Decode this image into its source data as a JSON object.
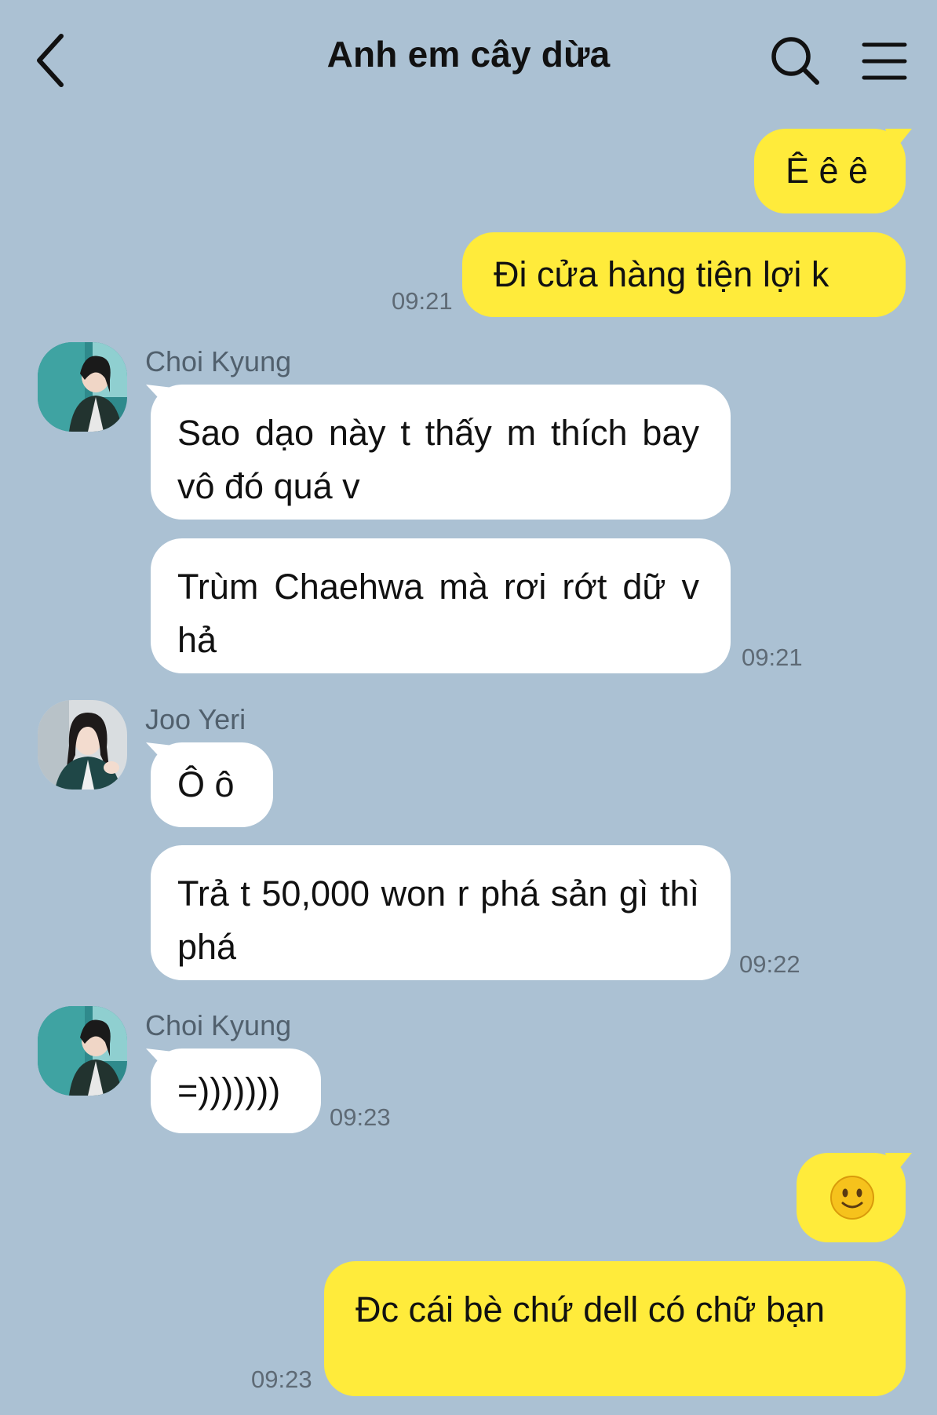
{
  "header": {
    "title": "Anh em cây dừa",
    "back_icon": "chevron-left-icon",
    "search_icon": "search-icon",
    "menu_icon": "hamburger-menu-icon"
  },
  "colors": {
    "background": "#abc1d3",
    "my_bubble": "#ffeb3b",
    "their_bubble": "#ffffff",
    "timestamp": "#5e6a75",
    "sender_name": "#51606d"
  },
  "messages": [
    {
      "from": "me",
      "text": "Ê ê ê"
    },
    {
      "from": "me",
      "text": "Đi cửa hàng tiện lợi k",
      "time": "09:21"
    },
    {
      "from": "Choi Kyung",
      "sender_label": "Choi Kyung",
      "text": "Sao dạo này t thấy m thích bay vô đó quá v"
    },
    {
      "from": "Choi Kyung",
      "text": "Trùm Chaehwa mà rơi rớt dữ v hả",
      "time": "09:21"
    },
    {
      "from": "Joo Yeri",
      "sender_label": "Joo Yeri",
      "text": "Ô ô"
    },
    {
      "from": "Joo Yeri",
      "text": "Trả t 50,000 won r phá sản gì thì phá",
      "time": "09:22"
    },
    {
      "from": "Choi Kyung",
      "sender_label": "Choi Kyung",
      "text": "=)))))))",
      "time": "09:23"
    },
    {
      "from": "me",
      "emoji": "slightly-smiling-face-emoji"
    },
    {
      "from": "me",
      "text": "Đc cái bè chứ dell có chữ bạn",
      "time": "09:23"
    }
  ]
}
